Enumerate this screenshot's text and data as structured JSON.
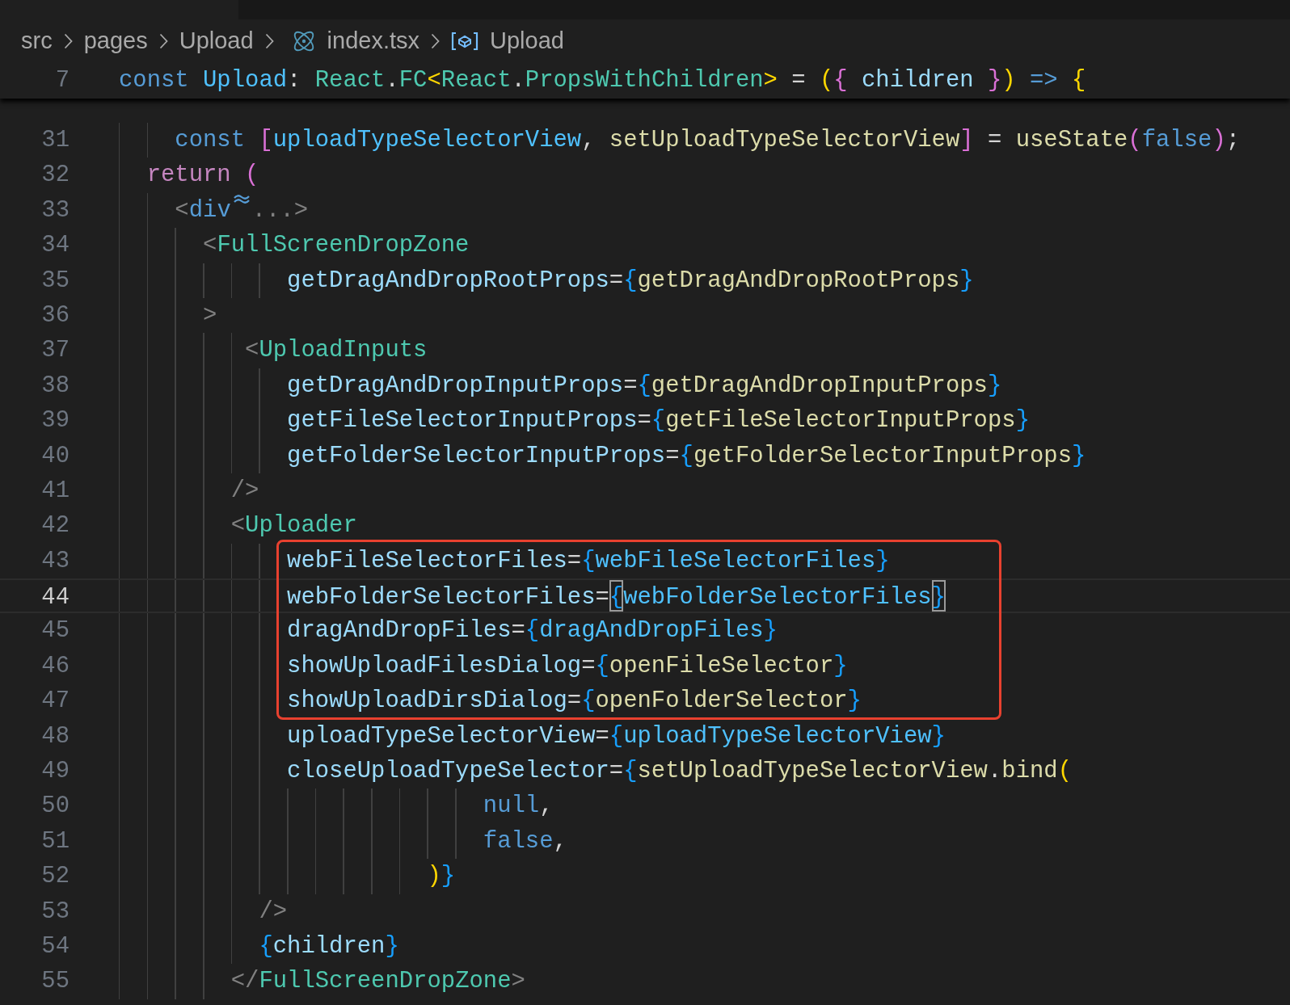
{
  "breadcrumb": [
    {
      "kind": "folder",
      "text": "src"
    },
    {
      "kind": "folder",
      "text": "pages"
    },
    {
      "kind": "folder",
      "text": "Upload"
    },
    {
      "kind": "file",
      "text": "index.tsx"
    },
    {
      "kind": "symbol",
      "text": "Upload"
    }
  ],
  "sticky_line": {
    "number": "7",
    "tokens": [
      {
        "kind": "kw",
        "text": "const "
      },
      {
        "kind": "const",
        "text": "Upload"
      },
      {
        "kind": "punct",
        "text": ": "
      },
      {
        "kind": "type",
        "text": "React"
      },
      {
        "kind": "punct",
        "text": "."
      },
      {
        "kind": "type",
        "text": "FC"
      },
      {
        "kind": "b1",
        "text": "<"
      },
      {
        "kind": "type",
        "text": "React"
      },
      {
        "kind": "punct",
        "text": "."
      },
      {
        "kind": "type",
        "text": "PropsWithChildren"
      },
      {
        "kind": "b1",
        "text": ">"
      },
      {
        "kind": "punct",
        "text": " = "
      },
      {
        "kind": "b1",
        "text": "("
      },
      {
        "kind": "b2",
        "text": "{"
      },
      {
        "kind": "var",
        "text": " children "
      },
      {
        "kind": "b2",
        "text": "}"
      },
      {
        "kind": "b1",
        "text": ")"
      },
      {
        "kind": "kw",
        "text": " => "
      },
      {
        "kind": "b1",
        "text": "{"
      }
    ]
  },
  "blocks": [
    {
      "kind": "plain",
      "lines": [
        {
          "number": "31",
          "current": false,
          "tokens": [
            {
              "kind": "kw",
              "text": "const "
            },
            {
              "kind": "b2",
              "text": "["
            },
            {
              "kind": "const",
              "text": "uploadTypeSelectorView"
            },
            {
              "kind": "punct",
              "text": ", "
            },
            {
              "kind": "func",
              "text": "setUploadTypeSelectorView"
            },
            {
              "kind": "b2",
              "text": "]"
            },
            {
              "kind": "punct",
              "text": " = "
            },
            {
              "kind": "func",
              "text": "useState"
            },
            {
              "kind": "b2",
              "text": "("
            },
            {
              "kind": "kw",
              "text": "false"
            },
            {
              "kind": "b2",
              "text": ")"
            },
            {
              "kind": "punct",
              "text": ";"
            }
          ]
        },
        {
          "number": "32",
          "current": false,
          "tokens": [
            {
              "kind": "ctrl",
              "text": "return "
            },
            {
              "kind": "b2",
              "text": "("
            }
          ]
        },
        {
          "number": "33",
          "current": false,
          "tokens": [
            {
              "kind": "tag",
              "text": "<"
            },
            {
              "kind": "kw",
              "text": "div"
            },
            {
              "kind": "fold"
            },
            {
              "kind": "tag",
              "text": "...>"
            }
          ]
        },
        {
          "number": "34",
          "current": false,
          "tokens": [
            {
              "kind": "tag",
              "text": "<"
            },
            {
              "kind": "type",
              "text": "FullScreenDropZone"
            }
          ]
        },
        {
          "number": "35",
          "current": false,
          "tokens": [
            {
              "kind": "var",
              "text": "getDragAndDropRootProps"
            },
            {
              "kind": "punct",
              "text": "="
            },
            {
              "kind": "b3",
              "text": "{"
            },
            {
              "kind": "func",
              "text": "getDragAndDropRootProps"
            },
            {
              "kind": "b3",
              "text": "}"
            }
          ]
        },
        {
          "number": "36",
          "current": false,
          "tokens": [
            {
              "kind": "tag",
              "text": ">"
            }
          ]
        },
        {
          "number": "37",
          "current": false,
          "tokens": [
            {
              "kind": "tag",
              "text": "<"
            },
            {
              "kind": "type",
              "text": "UploadInputs"
            }
          ]
        },
        {
          "number": "38",
          "current": false,
          "tokens": [
            {
              "kind": "var",
              "text": "getDragAndDropInputProps"
            },
            {
              "kind": "punct",
              "text": "="
            },
            {
              "kind": "b3",
              "text": "{"
            },
            {
              "kind": "func",
              "text": "getDragAndDropInputProps"
            },
            {
              "kind": "b3",
              "text": "}"
            }
          ]
        },
        {
          "number": "39",
          "current": false,
          "tokens": [
            {
              "kind": "var",
              "text": "getFileSelectorInputProps"
            },
            {
              "kind": "punct",
              "text": "="
            },
            {
              "kind": "b3",
              "text": "{"
            },
            {
              "kind": "func",
              "text": "getFileSelectorInputProps"
            },
            {
              "kind": "b3",
              "text": "}"
            }
          ]
        },
        {
          "number": "40",
          "current": false,
          "tokens": [
            {
              "kind": "var",
              "text": "getFolderSelectorInputProps"
            },
            {
              "kind": "punct",
              "text": "="
            },
            {
              "kind": "b3",
              "text": "{"
            },
            {
              "kind": "func",
              "text": "getFolderSelectorInputProps"
            },
            {
              "kind": "b3",
              "text": "}"
            }
          ]
        },
        {
          "number": "41",
          "current": false,
          "tokens": [
            {
              "kind": "tag",
              "text": "/>"
            }
          ]
        },
        {
          "number": "42",
          "current": false,
          "tokens": [
            {
              "kind": "tag",
              "text": "<"
            },
            {
              "kind": "type",
              "text": "Uploader"
            }
          ]
        }
      ]
    },
    {
      "kind": "highlighted",
      "lines": [
        {
          "number": "43",
          "current": false,
          "tokens": [
            {
              "kind": "var",
              "text": "webFileSelectorFiles"
            },
            {
              "kind": "punct",
              "text": "="
            },
            {
              "kind": "b3",
              "text": "{"
            },
            {
              "kind": "const",
              "text": "webFileSelectorFiles"
            },
            {
              "kind": "b3",
              "text": "}"
            }
          ]
        },
        {
          "number": "44",
          "current": true,
          "tokens": [
            {
              "kind": "var",
              "text": "webFolderSelectorFiles"
            },
            {
              "kind": "punct",
              "text": "="
            },
            {
              "kind": "b3",
              "text": "{",
              "matched": true
            },
            {
              "kind": "const",
              "text": "webFolderSelectorFiles"
            },
            {
              "kind": "b3",
              "text": "}",
              "matched": true
            }
          ]
        },
        {
          "number": "45",
          "current": false,
          "tokens": [
            {
              "kind": "var",
              "text": "dragAndDropFiles"
            },
            {
              "kind": "punct",
              "text": "="
            },
            {
              "kind": "b3",
              "text": "{"
            },
            {
              "kind": "const",
              "text": "dragAndDropFiles"
            },
            {
              "kind": "b3",
              "text": "}"
            }
          ]
        },
        {
          "number": "46",
          "current": false,
          "tokens": [
            {
              "kind": "var",
              "text": "showUploadFilesDialog"
            },
            {
              "kind": "punct",
              "text": "="
            },
            {
              "kind": "b3",
              "text": "{"
            },
            {
              "kind": "func",
              "text": "openFileSelector"
            },
            {
              "kind": "b3",
              "text": "}"
            }
          ]
        },
        {
          "number": "47",
          "current": false,
          "tokens": [
            {
              "kind": "var",
              "text": "showUploadDirsDialog"
            },
            {
              "kind": "punct",
              "text": "="
            },
            {
              "kind": "b3",
              "text": "{"
            },
            {
              "kind": "func",
              "text": "openFolderSelector"
            },
            {
              "kind": "b3",
              "text": "}"
            }
          ]
        }
      ]
    },
    {
      "kind": "plain",
      "lines": [
        {
          "number": "48",
          "current": false,
          "tokens": [
            {
              "kind": "var",
              "text": "uploadTypeSelectorView"
            },
            {
              "kind": "punct",
              "text": "="
            },
            {
              "kind": "b3",
              "text": "{"
            },
            {
              "kind": "const",
              "text": "uploadTypeSelectorView"
            },
            {
              "kind": "b3",
              "text": "}"
            }
          ]
        },
        {
          "number": "49",
          "current": false,
          "tokens": [
            {
              "kind": "var",
              "text": "closeUploadTypeSelector"
            },
            {
              "kind": "punct",
              "text": "="
            },
            {
              "kind": "b3",
              "text": "{"
            },
            {
              "kind": "func",
              "text": "setUploadTypeSelectorView"
            },
            {
              "kind": "punct",
              "text": "."
            },
            {
              "kind": "func",
              "text": "bind"
            },
            {
              "kind": "b1",
              "text": "("
            }
          ]
        },
        {
          "number": "50",
          "current": false,
          "tokens": [
            {
              "kind": "kw",
              "text": "null"
            },
            {
              "kind": "punct",
              "text": ","
            }
          ]
        },
        {
          "number": "51",
          "current": false,
          "tokens": [
            {
              "kind": "kw",
              "text": "false"
            },
            {
              "kind": "punct",
              "text": ","
            }
          ]
        },
        {
          "number": "52",
          "current": false,
          "tokens": [
            {
              "kind": "b1",
              "text": ")"
            },
            {
              "kind": "b3",
              "text": "}"
            }
          ]
        },
        {
          "number": "53",
          "current": false,
          "tokens": [
            {
              "kind": "tag",
              "text": "/>"
            }
          ]
        },
        {
          "number": "54",
          "current": false,
          "tokens": [
            {
              "kind": "b3",
              "text": "{"
            },
            {
              "kind": "var",
              "text": "children"
            },
            {
              "kind": "b3",
              "text": "}"
            }
          ]
        },
        {
          "number": "55",
          "current": false,
          "tokens": [
            {
              "kind": "tag",
              "text": "</"
            },
            {
              "kind": "type",
              "text": "FullScreenDropZone"
            },
            {
              "kind": "tag",
              "text": ">"
            }
          ]
        }
      ]
    }
  ]
}
